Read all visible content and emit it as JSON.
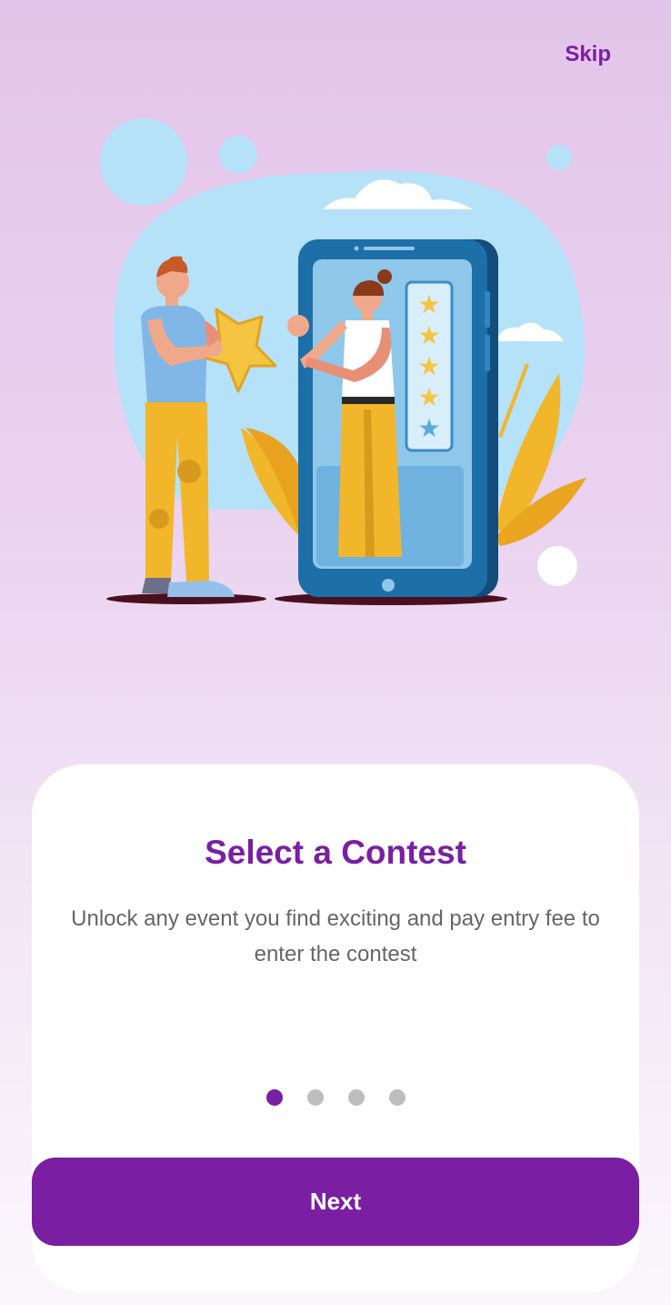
{
  "header": {
    "skip_label": "Skip"
  },
  "onboarding": {
    "title": "Select a Contest",
    "description": "Unlock any event you find exciting and pay entry fee to enter the contest",
    "page_count": 4,
    "active_page": 1,
    "next_label": "Next"
  },
  "colors": {
    "accent": "#7a1fa2",
    "dot_inactive": "#bdbdbd"
  },
  "illustration": {
    "icons": [
      "man-holding-star",
      "smartphone",
      "woman-in-phone",
      "star-rating-icon",
      "cloud-icon",
      "plant-leaves"
    ]
  }
}
